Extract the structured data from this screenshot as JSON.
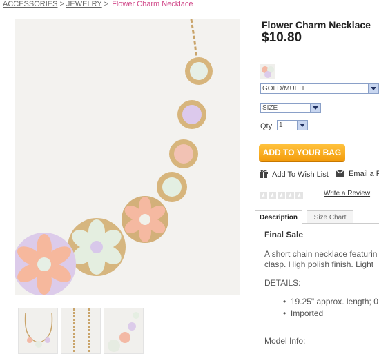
{
  "breadcrumb": {
    "items": [
      "ACCESSORIES",
      "JEWELRY"
    ],
    "separator": ">",
    "current": "Flower Charm Necklace"
  },
  "product": {
    "title": "Flower Charm Necklace",
    "price": "$10.80",
    "color_select": "GOLD/MULTI",
    "size_select": "SIZE",
    "qty_label": "Qty",
    "qty_value": "1",
    "add_to_bag": "ADD TO YOUR BAG",
    "wish_list": "Add To Wish List",
    "email": "Email a F",
    "write_review": "Write a Review"
  },
  "tabs": [
    {
      "label": "Description",
      "active": true
    },
    {
      "label": "Size Chart",
      "active": false
    }
  ],
  "description": {
    "heading": "Final Sale",
    "line1": "A short chain necklace featurin",
    "line2": "clasp. High polish finish. Light",
    "details_label": "DETAILS:",
    "bullets": [
      "19.25\" approx. length; 0",
      "Imported"
    ],
    "model_info": "Model Info:"
  },
  "colors": {
    "accent_pink": "#d14a8a",
    "button_orange": "#f7a21b"
  }
}
